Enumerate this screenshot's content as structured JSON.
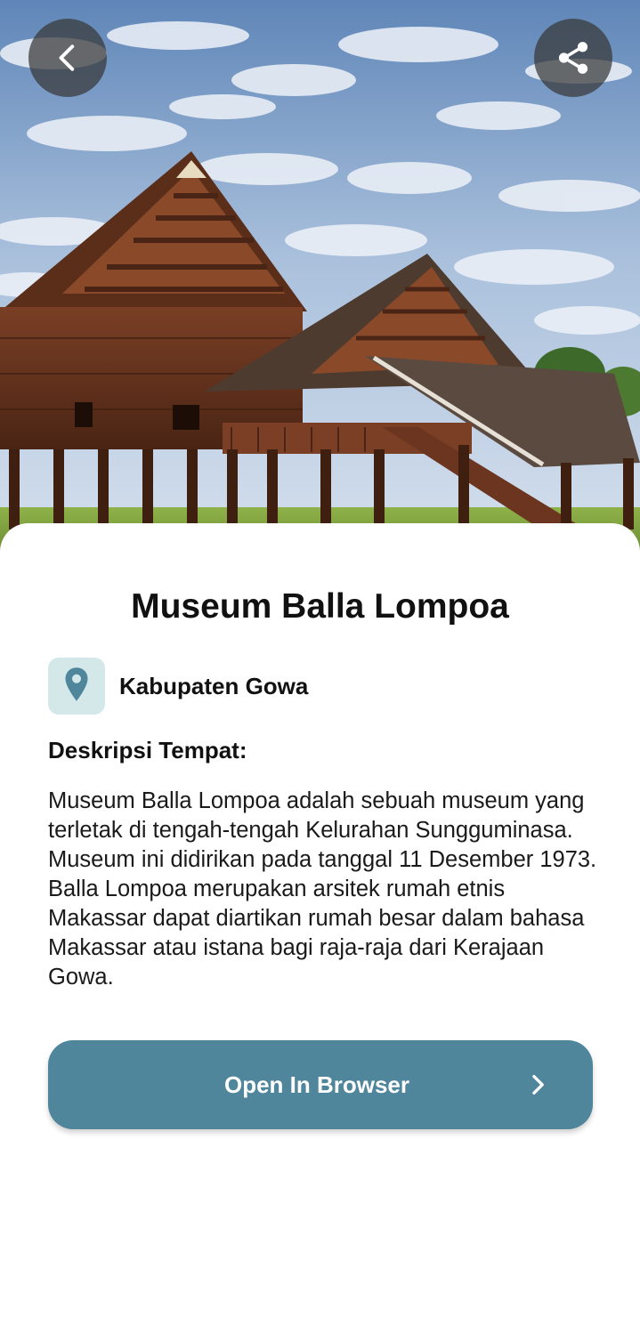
{
  "hero": {
    "image_description_icon": "museum-photo"
  },
  "toolbar": {
    "back_icon": "chevron-left-icon",
    "share_icon": "share-icon"
  },
  "place": {
    "title": "Museum Balla Lompoa",
    "location_icon": "map-pin-icon",
    "location": "Kabupaten Gowa",
    "description_heading": "Deskripsi Tempat:",
    "description": "Museum Balla Lompoa adalah sebuah museum yang terletak di tengah-tengah Kelurahan Sungguminasa. Museum ini didirikan pada tanggal 11 Desember 1973. Balla Lompoa merupakan arsitek rumah etnis Makassar dapat diartikan rumah besar dalam bahasa Makassar atau istana bagi raja-raja dari Kerajaan Gowa."
  },
  "actions": {
    "open_browser_label": "Open In Browser"
  },
  "colors": {
    "accent": "#4f869c",
    "location_badge_bg": "#d5e8e9",
    "pin": "#4f869c"
  }
}
